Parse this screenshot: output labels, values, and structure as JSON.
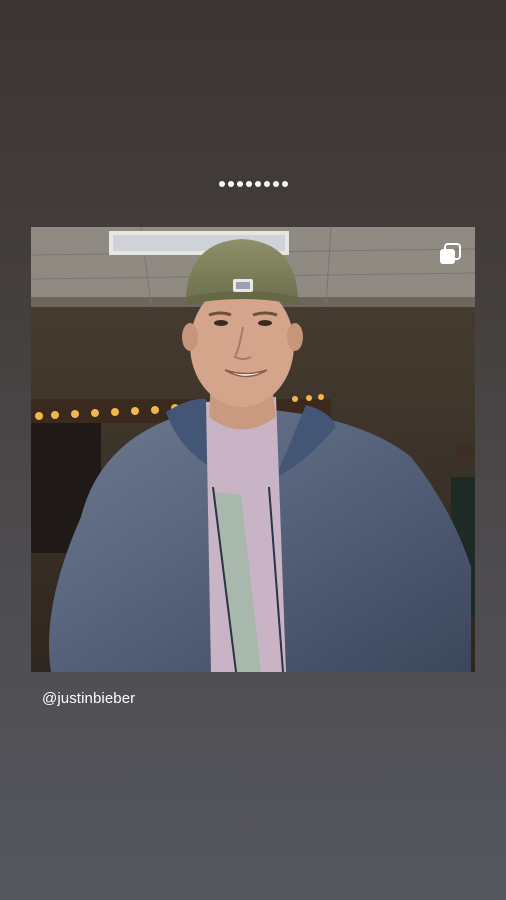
{
  "story": {
    "progress_segments": 8,
    "mention": "@justinbieber"
  },
  "post": {
    "multi_photo_icon": "carousel-icon"
  }
}
